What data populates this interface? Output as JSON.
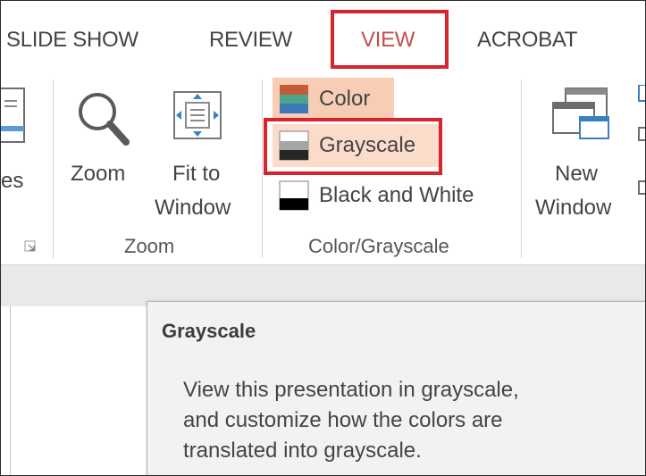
{
  "tabs": [
    {
      "label": "SLIDE SHOW"
    },
    {
      "label": "REVIEW"
    },
    {
      "label": "VIEW"
    },
    {
      "label": "ACROBAT"
    }
  ],
  "ribbon": {
    "partial_button_label": "es",
    "zoom_group": {
      "zoom_label": "Zoom",
      "fit_line1": "Fit to",
      "fit_line2": "Window",
      "group_label": "Zoom"
    },
    "color_group": {
      "color_label": "Color",
      "grayscale_label": "Grayscale",
      "bw_label": "Black and White",
      "group_label": "Color/Grayscale"
    },
    "window_group": {
      "new_line1": "New",
      "new_line2": "Window"
    }
  },
  "tooltip": {
    "title": "Grayscale",
    "lines": [
      "View this presentation in grayscale,",
      "and customize how the colors are",
      "translated into grayscale."
    ]
  },
  "colors": {
    "highlight_red": "#d9232d",
    "active_tab": "#c0504d",
    "color_highlight": "#f8cdb5",
    "grayscale_highlight": "#fbdccb"
  }
}
